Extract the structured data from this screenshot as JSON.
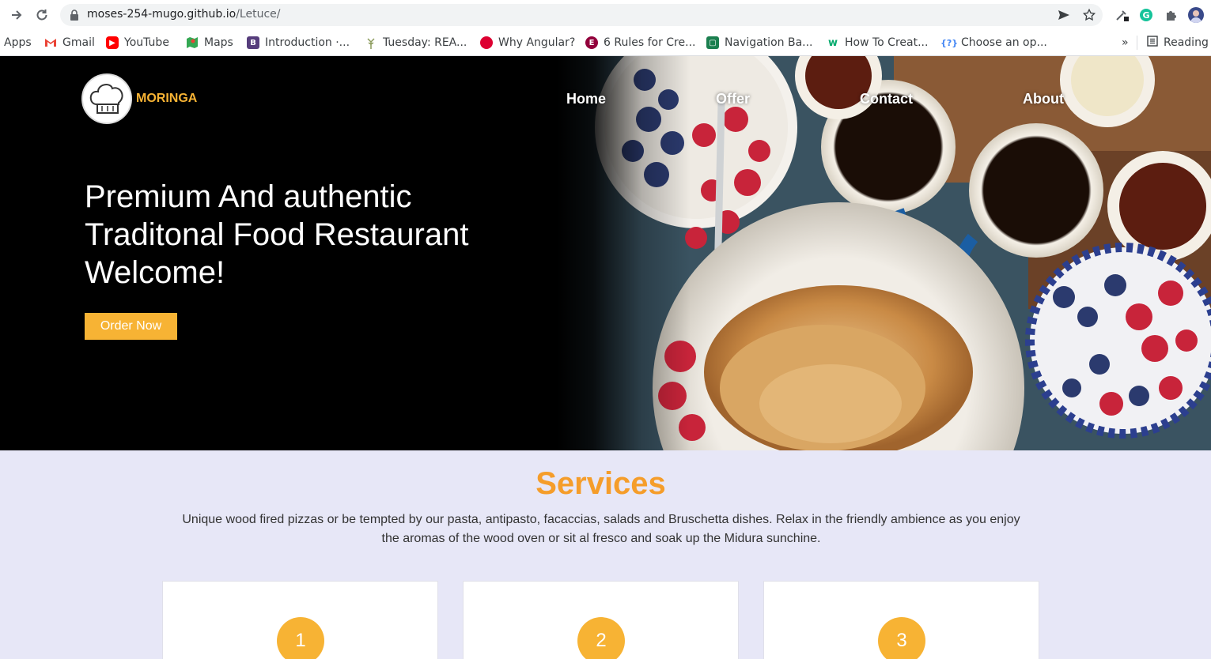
{
  "browser": {
    "url_host": "moses-254-mugo.github.io",
    "url_path": "/Letuce/",
    "bookmarks": [
      {
        "label": "Apps",
        "icon": "apps-grid-icon"
      },
      {
        "label": "Gmail",
        "icon": "gmail-icon",
        "color": "#ea4335"
      },
      {
        "label": "YouTube",
        "icon": "youtube-icon",
        "color": "#ff0000"
      },
      {
        "label": "Maps",
        "icon": "maps-icon",
        "color": "#34a853"
      },
      {
        "label": "Introduction ·...",
        "icon": "bootstrap-icon",
        "color": "#563d7c"
      },
      {
        "label": "Tuesday: REA...",
        "icon": "tree-icon",
        "color": "#8a9a5b"
      },
      {
        "label": "Why Angular?",
        "icon": "angular-icon",
        "color": "#dd0031"
      },
      {
        "label": "6 Rules for Cre...",
        "icon": "elementor-icon",
        "color": "#92003b"
      },
      {
        "label": "Navigation Ba...",
        "icon": "green-box-icon",
        "color": "#1b7f4f"
      },
      {
        "label": "How To Creat...",
        "icon": "w3-icon",
        "color": "#04aa6d"
      },
      {
        "label": "Choose an op...",
        "icon": "braces-icon",
        "color": "#4285f4"
      }
    ],
    "overflow": "»",
    "reading_list": "Reading"
  },
  "nav": {
    "brand": "MORINGA",
    "links": [
      "Home",
      "Offer",
      "Contact",
      "About"
    ]
  },
  "hero": {
    "line1": "Premium And authentic",
    "line2": "Traditonal Food Restaurant",
    "line3": "Welcome!",
    "cta": "Order Now"
  },
  "services": {
    "title": "Services",
    "description": "Unique wood fired pizzas or be tempted by our pasta, antipasto, facaccias, salads and Bruschetta dishes. Relax in the friendly ambience as you enjoy the aromas of the wood oven or sit al fresco and soak up the Midura sunchine.",
    "cards": [
      "1",
      "2",
      "3"
    ]
  },
  "colors": {
    "accent": "#f7b334",
    "services_title": "#f59d2a",
    "services_bg": "#e7e7f7"
  }
}
